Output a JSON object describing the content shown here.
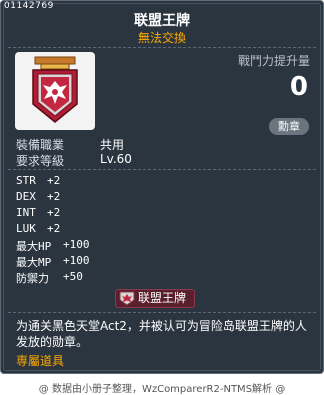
{
  "item": {
    "id": "01142769",
    "name": "联盟王牌",
    "trade_status": "無法交換"
  },
  "combat": {
    "label": "戰鬥力提升量",
    "value": "0",
    "badge_button": "勳章"
  },
  "requirements": [
    {
      "label": "裝備職業",
      "value": "共用"
    },
    {
      "label": "要求等級",
      "value": "Lv.60"
    }
  ],
  "stats": [
    {
      "name": "STR",
      "value": "+2"
    },
    {
      "name": "DEX",
      "value": "+2"
    },
    {
      "name": "INT",
      "value": "+2"
    },
    {
      "name": "LUK",
      "value": "+2"
    },
    {
      "name": "最大HP",
      "value": "+100"
    },
    {
      "name": "最大MP",
      "value": "+100"
    },
    {
      "name": "防禦力",
      "value": "+50"
    }
  ],
  "set_badge": "联盟王牌",
  "description": "为通关黑色天堂Act2，并被认可为冒险岛联盟王牌的人发放的勋章。",
  "exclusive_tag": "専屬道具",
  "credit": "@ 数据由小册子整理，WzComparerR2-NTMS解析 @",
  "colors": {
    "card_bg": "#2b3540",
    "accent_orange": "#ffaa00",
    "medal_red": "#b01e35"
  },
  "icons": {
    "item": "union-ace-medal-icon",
    "set": "union-ace-medal-icon"
  }
}
